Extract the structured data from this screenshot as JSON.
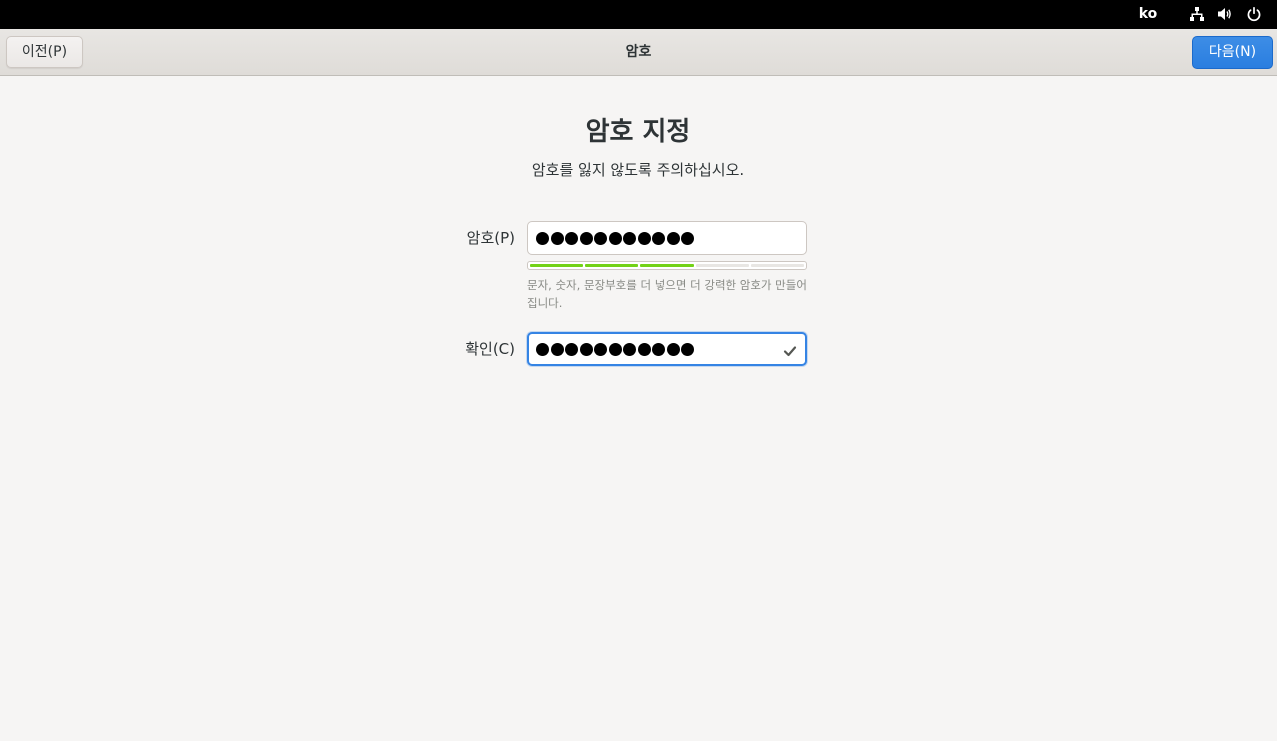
{
  "top_panel": {
    "language": "ko",
    "icons": [
      "network-icon",
      "volume-icon",
      "power-icon"
    ]
  },
  "header": {
    "back_label": "이전(P)",
    "title": "암호",
    "next_label": "다음(N)"
  },
  "main": {
    "heading": "암호 지정",
    "subheading": "암호를 잃지 않도록 주의하십시오.",
    "password_label": "암호(P)",
    "password_dot_count": 11,
    "strength_level": 0.6,
    "strength_segments": 5,
    "hint": "문자, 숫자, 문장부호를 더 넣으면 더 강력한 암호가 만들어집니다.",
    "confirm_label": "확인(C)",
    "confirm_dot_count": 11,
    "confirm_match_icon": "check-icon"
  },
  "colors": {
    "accent": "#3584e4",
    "strength_fill": "#73d216",
    "panel_bg": "#000000",
    "page_bg": "#f6f5f4"
  }
}
